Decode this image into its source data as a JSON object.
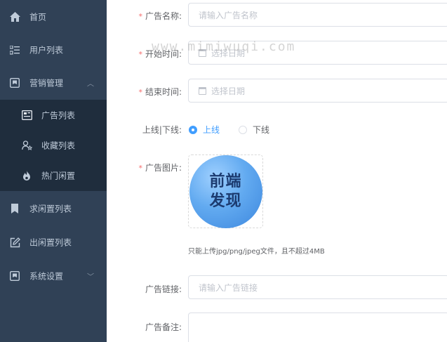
{
  "sidebar": {
    "items": [
      {
        "label": "首页",
        "icon": "home-icon"
      },
      {
        "label": "用户列表",
        "icon": "list-icon"
      },
      {
        "label": "营销管理",
        "icon": "marketing-icon",
        "expanded": true
      },
      {
        "label": "求闲置列表",
        "icon": "bookmark-icon"
      },
      {
        "label": "出闲置列表",
        "icon": "edit-icon"
      },
      {
        "label": "系统设置",
        "icon": "settings-icon"
      }
    ],
    "submenu": [
      {
        "label": "广告列表",
        "icon": "ad-icon"
      },
      {
        "label": "收藏列表",
        "icon": "user-star-icon"
      },
      {
        "label": "热门闲置",
        "icon": "fire-icon"
      }
    ]
  },
  "form": {
    "ad_name_label": "广告名称:",
    "ad_name_placeholder": "请输入广告名称",
    "start_time_label": "开始时间:",
    "start_time_placeholder": "选择日期",
    "end_time_label": "结束时间:",
    "end_time_placeholder": "选择日期",
    "online_label": "上线|下线:",
    "online_option": "上线",
    "offline_option": "下线",
    "image_label": "广告图片:",
    "image_text_line1": "前端",
    "image_text_line2": "发现",
    "upload_tip": "只能上传jpg/png/jpeg文件，且不超过4MB",
    "link_label": "广告链接:",
    "link_placeholder": "请输入广告链接",
    "remark_label": "广告备注:"
  },
  "watermark": "www.mimiwuqi.com",
  "colors": {
    "sidebar_bg": "#304156",
    "submenu_bg": "#1f2d3d",
    "accent": "#409eff",
    "required": "#f56c6c"
  }
}
